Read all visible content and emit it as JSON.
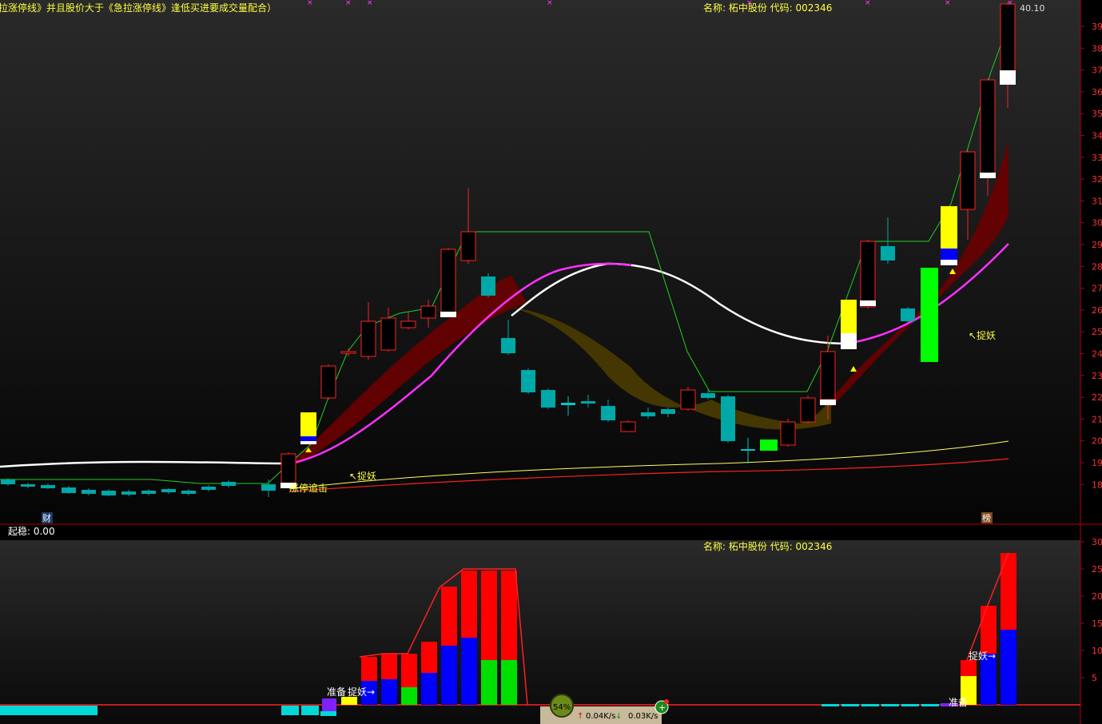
{
  "main_panel": {
    "formula_title": "拉涨停线》并且股价大于《急拉涨停线》逢低买进要成交量配合）",
    "stock_info": "名称: 柘中股份  代码: 002346",
    "high_price_label": "40.10",
    "right_axis_ticks": [
      "39",
      "38",
      "37",
      "36",
      "35",
      "34",
      "33",
      "32",
      "31",
      "30",
      "29",
      "28",
      "27",
      "26",
      "25",
      "24",
      "23",
      "22",
      "21",
      "20",
      "19",
      "18"
    ],
    "annotations": [
      {
        "text": "涨停追击",
        "kind": "signal"
      },
      {
        "text": "↖捉妖",
        "kind": "signal"
      },
      {
        "text": "↖捉妖",
        "kind": "signal"
      }
    ],
    "bottom_markers": [
      "财",
      "榜"
    ]
  },
  "sub_panel": {
    "indicator_label": "起稳: 0.00",
    "stock_info": "名称: 柘中股份  代码: 002346",
    "right_axis_ticks": [
      "30",
      "25",
      "20",
      "15",
      "10",
      "5"
    ],
    "annotations": [
      {
        "text": "准备",
        "kind": "signal"
      },
      {
        "text": "捉妖→",
        "kind": "signal"
      },
      {
        "text": "捉妖→",
        "kind": "signal"
      },
      {
        "text": "准备",
        "kind": "signal"
      }
    ]
  },
  "network_widget": {
    "cpu_percent": "54%",
    "upload_speed": "0.04K/s",
    "download_speed": "0.03K/s"
  },
  "colors": {
    "background": "#000000",
    "up_candle_border": "#ff2020",
    "down_candle": "#00a8a8",
    "signal_yellow": "#ffff00",
    "signal_blue": "#0000ff",
    "signal_green": "#00ff00",
    "signal_red": "#ff0000",
    "ma_white": "#ffffff",
    "ma_magenta": "#ff30ff",
    "ma_green": "#20d020",
    "ma_yellow": "#ffff60",
    "ma_red": "#ff2020",
    "cloud_dark_red": "#6a0000",
    "cloud_olive": "#4a3c00"
  },
  "icons": [
    "cpu-lamp-icon",
    "upload-arrow-icon",
    "download-arrow-icon",
    "add-plus-icon",
    "marker-x-icon"
  ]
}
